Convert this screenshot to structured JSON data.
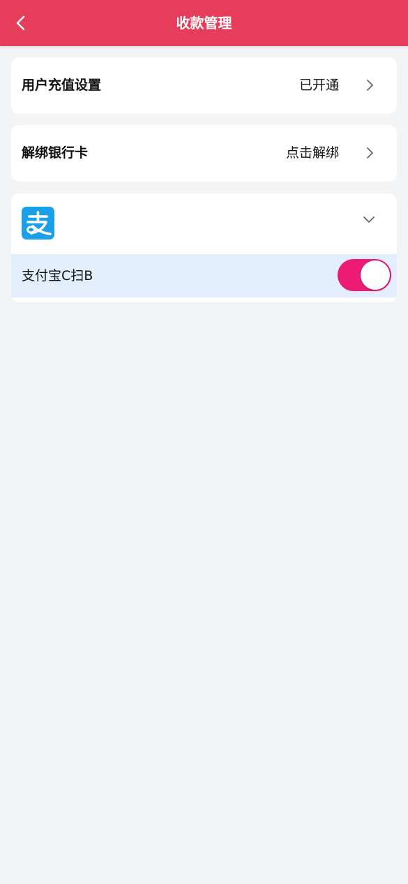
{
  "header": {
    "title": "收款管理",
    "back_icon": "chevron-left-icon",
    "background": "#e63d5a"
  },
  "settings": [
    {
      "label": "用户充值设置",
      "value": "已开通",
      "icon": "chevron-right-icon"
    },
    {
      "label": "解绑银行卡",
      "value": "点击解绑",
      "icon": "chevron-right-icon"
    }
  ],
  "payment_group": {
    "logo_icon": "alipay-logo-icon",
    "logo_color": "#1aa0e8",
    "expand_icon": "chevron-down-icon",
    "expanded": true,
    "methods": [
      {
        "label": "支付宝C扫B",
        "enabled": true,
        "toggle_color": "#ee1b74"
      }
    ]
  }
}
